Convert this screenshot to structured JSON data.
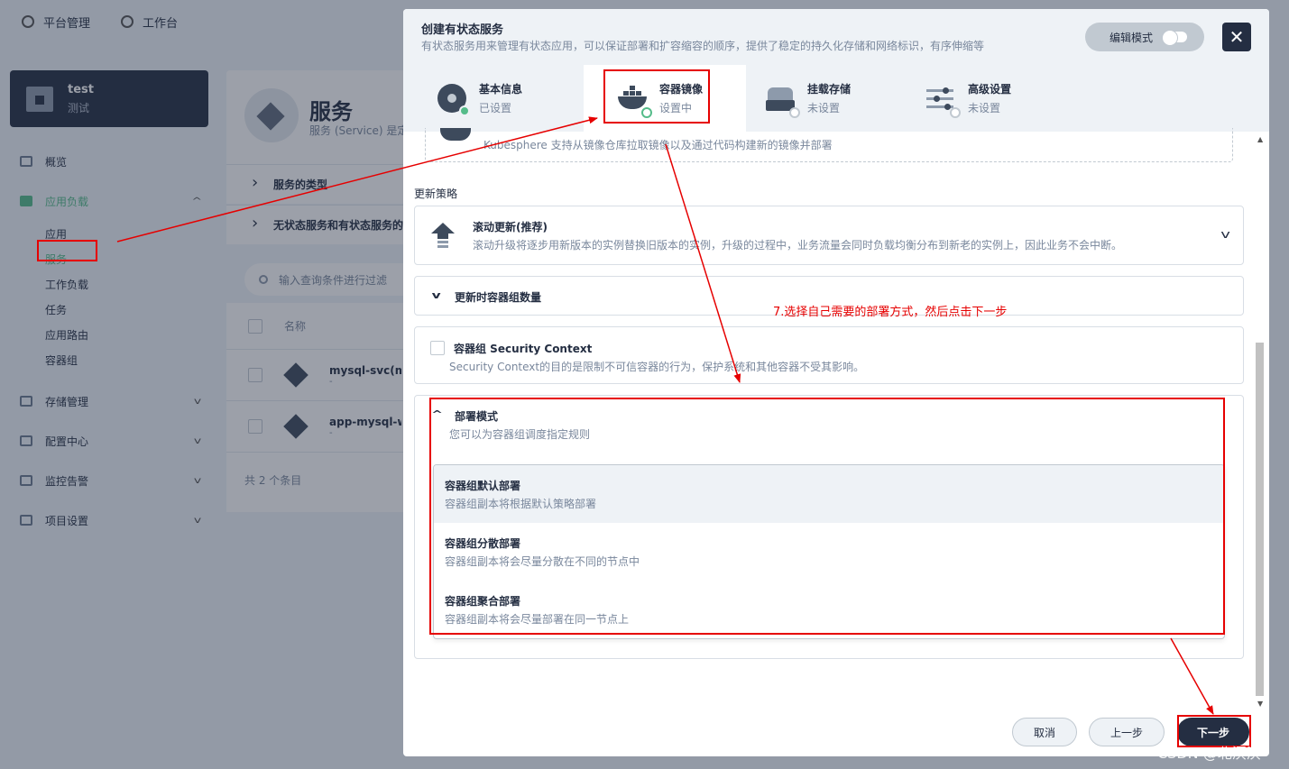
{
  "topbar": {
    "platform": "平台管理",
    "workbench": "工作台"
  },
  "workspace": {
    "name": "test",
    "desc": "测试"
  },
  "sidebar": {
    "overview": "概览",
    "workloads": "应用负载",
    "sub_items": [
      "应用",
      "服务",
      "工作负载",
      "任务",
      "应用路由",
      "容器组"
    ],
    "storage": "存储管理",
    "config": "配置中心",
    "monitoring": "监控告警",
    "project_settings": "项目设置"
  },
  "service_page": {
    "title": "服务",
    "desc": "服务 (Service) 是定",
    "info_rows": [
      "服务的类型",
      "无状态服务和有状态服务的"
    ],
    "search_placeholder": "输入查询条件进行过滤",
    "col_name": "名称",
    "rows": [
      {
        "name": "mysql-svc(my",
        "sub": "-"
      },
      {
        "name": "app-mysql-wy",
        "sub": "-"
      }
    ],
    "total": "共 2 个条目"
  },
  "modal": {
    "title": "创建有状态服务",
    "desc": "有状态服务用来管理有状态应用，可以保证部署和扩容缩容的顺序，提供了稳定的持久化存储和网络标识，有序伸缩等",
    "edit_mode": "编辑模式",
    "close": "✕",
    "steps": [
      {
        "title": "基本信息",
        "status": "已设置"
      },
      {
        "title": "容器镜像",
        "status": "设置中"
      },
      {
        "title": "挂载存储",
        "status": "未设置"
      },
      {
        "title": "高级设置",
        "status": "未设置"
      }
    ],
    "image_hint": "Kubesphere 支持从镜像仓库拉取镜像以及通过代码构建新的镜像并部署",
    "update_strategy_label": "更新策略",
    "strategy": {
      "title": "滚动更新(推荐)",
      "desc": "滚动升级将逐步用新版本的实例替换旧版本的实例，升级的过程中，业务流量会同时负载均衡分布到新老的实例上，因此业务不会中断。"
    },
    "replicas_label": "更新时容器组数量",
    "security": {
      "title": "容器组 Security Context",
      "desc": "Security Context的目的是限制不可信容器的行为，保护系统和其他容器不受其影响。"
    },
    "deploy": {
      "title": "部署模式",
      "desc": "您可以为容器组调度指定规则",
      "options": [
        {
          "title": "容器组默认部署",
          "desc": "容器组副本将根据默认策略部署"
        },
        {
          "title": "容器组分散部署",
          "desc": "容器组副本将会尽量分散在不同的节点中"
        },
        {
          "title": "容器组聚合部署",
          "desc": "容器组副本将会尽量部署在同一节点上"
        }
      ]
    },
    "buttons": {
      "cancel": "取消",
      "prev": "上一步",
      "next": "下一步"
    }
  },
  "annotation": {
    "text": "7.选择自己需要的部署方式，然后点击下一步",
    "color": "#e60000"
  },
  "watermark": "CSDN @北溟溟",
  "colors": {
    "dark": "#242e42",
    "green": "#55bc8a",
    "grey_text": "#79879c",
    "bg": "#eff4f9"
  }
}
